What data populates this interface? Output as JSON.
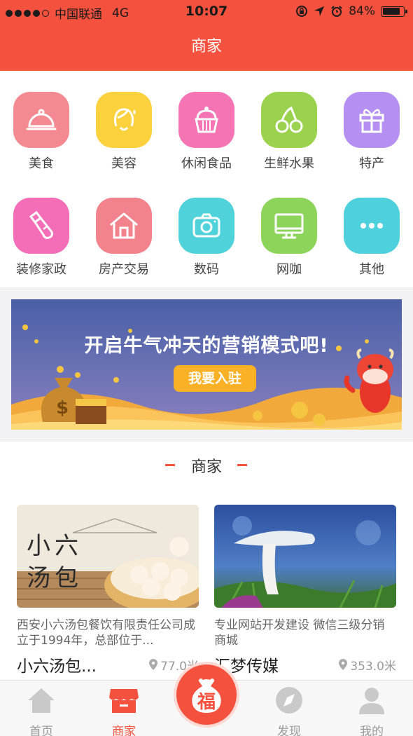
{
  "status_bar": {
    "carrier": "中国联通",
    "network": "4G",
    "time": "10:07",
    "battery": "84%",
    "battery_level": 0.84
  },
  "header": {
    "title": "商家"
  },
  "categories": [
    {
      "label": "美食",
      "icon": "cloche-icon",
      "color": "#f48a91"
    },
    {
      "label": "美容",
      "icon": "face-icon",
      "color": "#fcd13e"
    },
    {
      "label": "休闲食品",
      "icon": "cake-icon",
      "color": "#f574b4"
    },
    {
      "label": "生鲜水果",
      "icon": "cherry-icon",
      "color": "#9bd24d"
    },
    {
      "label": "特产",
      "icon": "gift-icon",
      "color": "#b58ff2"
    },
    {
      "label": "装修家政",
      "icon": "brush-icon",
      "color": "#f36eb7"
    },
    {
      "label": "房产交易",
      "icon": "house-icon",
      "color": "#f2838c"
    },
    {
      "label": "数码",
      "icon": "camera-icon",
      "color": "#4fd2da"
    },
    {
      "label": "网咖",
      "icon": "monitor-icon",
      "color": "#8cd55a"
    },
    {
      "label": "其他",
      "icon": "more-icon",
      "color": "#4ed1dc"
    }
  ],
  "banner": {
    "headline": "开启牛气冲天的营销模式吧!",
    "button_label": "我要入驻"
  },
  "section": {
    "title": "商家"
  },
  "merchants": [
    {
      "image_text": "小六汤包",
      "description": "西安小六汤包餐饮有限责任公司成立于1994年，总部位于...",
      "name": "小六汤包...",
      "distance": "77.0米"
    },
    {
      "description": "专业网站开发建设 微信三级分销商城",
      "name": "汇梦传媒",
      "distance": "353.0米"
    }
  ],
  "tabbar": {
    "home": "首页",
    "merchants": "商家",
    "center": "福",
    "discover": "发现",
    "mine": "我的"
  },
  "colors": {
    "accent": "#f4513f",
    "banner_button": "#fbb126"
  }
}
